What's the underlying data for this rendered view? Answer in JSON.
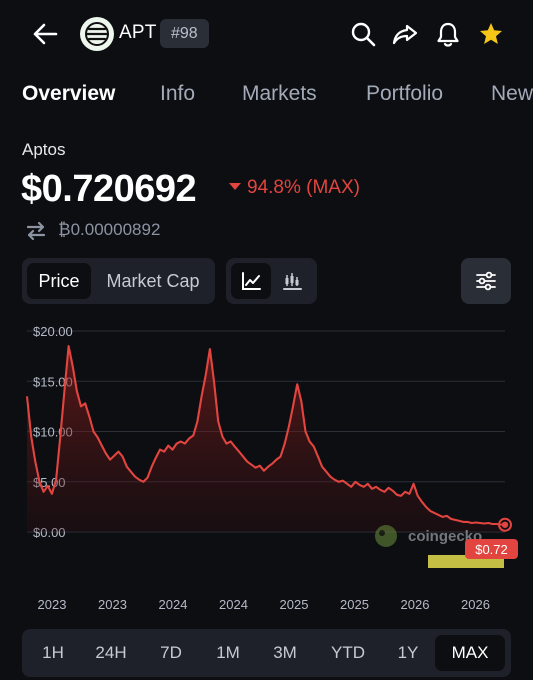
{
  "header": {
    "ticker": "APT",
    "rank": "#98",
    "icons": [
      "back-arrow-icon",
      "search-icon",
      "share-icon",
      "bell-icon",
      "star-icon"
    ],
    "star_color": "#f5c518"
  },
  "tabs": [
    {
      "label": "Overview",
      "active": true
    },
    {
      "label": "Info",
      "active": false
    },
    {
      "label": "Markets",
      "active": false
    },
    {
      "label": "Portfolio",
      "active": false
    },
    {
      "label": "New",
      "active": false
    }
  ],
  "coin": {
    "name": "Aptos",
    "price": "$0.720692",
    "change": "94.8% (MAX)",
    "change_direction": "down",
    "btc_price": "₿0.00000892"
  },
  "chart_toggle": {
    "options": [
      {
        "label": "Price",
        "active": true
      },
      {
        "label": "Market Cap",
        "active": false
      }
    ],
    "chart_types": [
      {
        "icon": "line-chart-icon",
        "active": true
      },
      {
        "icon": "candlestick-chart-icon",
        "active": false
      }
    ],
    "settings_icon": "sliders-icon"
  },
  "chart_data": {
    "type": "area",
    "title": "",
    "xlabel": "",
    "ylabel": "",
    "ylim": [
      0,
      20
    ],
    "y_ticks": [
      "$20.00",
      "$15.00",
      "$10.00",
      "$5.00",
      "$0.00"
    ],
    "y_tick_values": [
      20,
      15,
      10,
      5,
      0
    ],
    "x_ticks": [
      "2023",
      "2023",
      "2024",
      "2024",
      "2025",
      "2025",
      "2026",
      "2026"
    ],
    "grid": true,
    "line_color": "#e2453f",
    "watermark": "coingecko",
    "current_label": "$0.72",
    "series": [
      {
        "values": [
          13.5,
          9.5,
          7.0,
          5.0,
          4.0,
          4.6,
          3.8,
          5.2,
          9.5,
          14.0,
          18.5,
          16.5,
          14.0,
          12.5,
          12.8,
          11.5,
          10.0,
          9.4,
          8.6,
          7.8,
          7.2,
          7.6,
          8.0,
          7.5,
          6.5,
          6.0,
          5.5,
          5.2,
          5.0,
          5.4,
          6.5,
          7.4,
          8.2,
          8.0,
          8.6,
          8.2,
          8.8,
          9.0,
          8.8,
          9.3,
          9.6,
          11.0,
          13.5,
          15.6,
          18.2,
          15.0,
          11.0,
          9.5,
          8.8,
          9.0,
          8.5,
          8.0,
          7.5,
          7.0,
          6.7,
          6.4,
          6.6,
          6.1,
          6.5,
          6.8,
          7.2,
          7.5,
          8.8,
          10.5,
          12.5,
          14.7,
          13.0,
          10.0,
          9.0,
          8.5,
          7.5,
          6.5,
          6.0,
          5.5,
          5.2,
          5.0,
          5.1,
          4.8,
          4.5,
          5.0,
          4.7,
          4.5,
          4.8,
          4.3,
          4.5,
          4.2,
          4.0,
          4.4,
          4.1,
          3.7,
          3.6,
          4.0,
          3.8,
          4.8,
          3.6,
          3.0,
          2.5,
          2.1,
          1.9,
          1.7,
          1.5,
          1.6,
          1.3,
          1.2,
          1.1,
          1.0,
          1.0,
          0.9,
          0.95,
          0.9,
          0.85,
          0.9,
          0.8,
          0.8,
          0.75,
          0.72
        ]
      }
    ]
  },
  "ranges": [
    {
      "label": "1H",
      "active": false
    },
    {
      "label": "24H",
      "active": false
    },
    {
      "label": "7D",
      "active": false
    },
    {
      "label": "1M",
      "active": false
    },
    {
      "label": "3M",
      "active": false
    },
    {
      "label": "YTD",
      "active": false
    },
    {
      "label": "1Y",
      "active": false
    },
    {
      "label": "MAX",
      "active": true
    }
  ]
}
